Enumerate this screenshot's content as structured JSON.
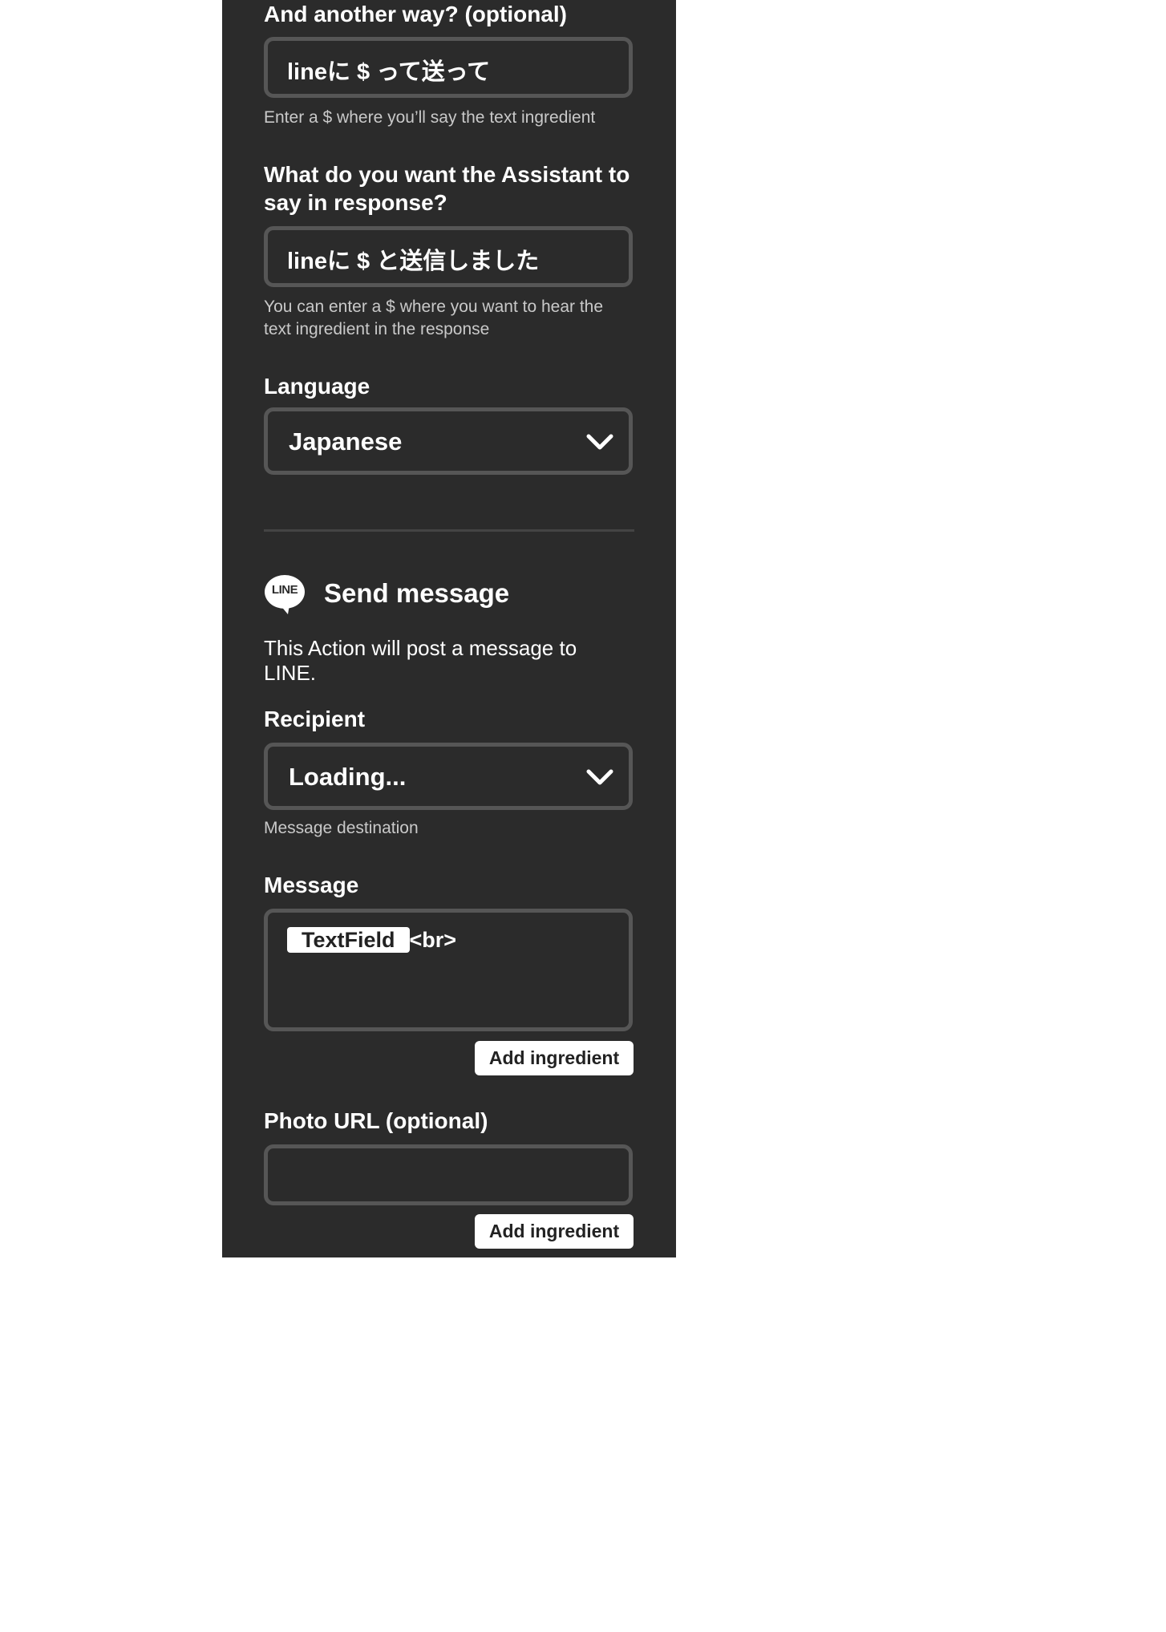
{
  "voice_trigger": {
    "another_way_label": "And another way? (optional)",
    "another_way_value": "lineに $ って送って",
    "another_way_help": "Enter a $ where you’ll say the text ingredient",
    "response_label": "What do you want the Assistant to say in response?",
    "response_value": "lineに $ と送信しました",
    "response_help": "You can enter a $ where you want to hear the text ingredient in the response",
    "language_label": "Language",
    "language_value": "Japanese"
  },
  "action": {
    "service_logo_text": "LINE",
    "title": "Send message",
    "description": "This Action will post a message to LINE.",
    "recipient_label": "Recipient",
    "recipient_value": "Loading...",
    "recipient_help": "Message destination",
    "message_label": "Message",
    "message_ingredient": "TextField",
    "message_suffix": "<br>",
    "add_ingredient_label": "Add ingredient",
    "photo_url_label": "Photo URL (optional)",
    "photo_url_value": "",
    "add_ingredient_label_2": "Add ingredient"
  },
  "icons": {
    "select_chevron": "chevron-down-icon",
    "service_logo": "line-logo-icon"
  },
  "colors": {
    "panel_background": "#2b2b2b",
    "field_border": "#565656",
    "help_text": "#c9c9c9",
    "button_background": "#ffffff"
  }
}
